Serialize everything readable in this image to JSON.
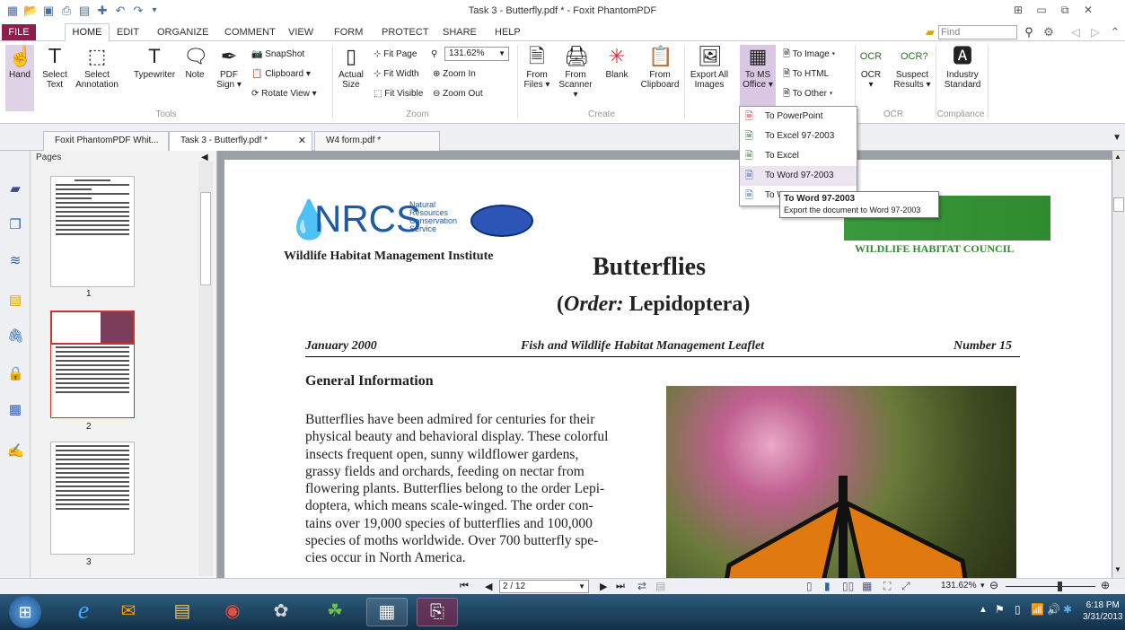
{
  "app": {
    "title": "Task 3 - Butterfly.pdf * - Foxit PhantomPDF"
  },
  "menu": {
    "file": "FILE",
    "tabs": [
      "HOME",
      "EDIT",
      "ORGANIZE",
      "COMMENT",
      "VIEW",
      "FORM",
      "PROTECT",
      "SHARE",
      "HELP"
    ],
    "find_placeholder": "Find"
  },
  "ribbon": {
    "tools": {
      "hand": "Hand",
      "select_text": [
        "Select",
        "Text"
      ],
      "select_annotation": [
        "Select",
        "Annotation"
      ],
      "typewriter": "Typewriter",
      "note": "Note",
      "pdf_sign": [
        "PDF",
        "Sign ▾"
      ],
      "snapshot": "SnapShot",
      "clipboard": "Clipboard ▾",
      "rotate_view": "Rotate View ▾",
      "group_label": "Tools"
    },
    "zoom": {
      "actual_size": [
        "Actual",
        "Size"
      ],
      "fit_page": "Fit Page",
      "fit_width": "Fit Width",
      "fit_visible": "Fit Visible",
      "zoom_value": "131.62%",
      "zoom_in": "Zoom In",
      "zoom_out": "Zoom Out",
      "group_label": "Zoom"
    },
    "create": {
      "from_files": [
        "From",
        "Files ▾"
      ],
      "from_scanner": [
        "From",
        "Scanner ▾"
      ],
      "blank": "Blank",
      "from_clipboard": [
        "From",
        "Clipboard"
      ],
      "group_label": "Create"
    },
    "convert": {
      "export_all_images": [
        "Export All",
        "Images"
      ],
      "to_ms_office": [
        "To MS",
        "Office ▾"
      ],
      "to_image": "To Image ▾",
      "to_html": "To HTML",
      "to_other": "To Other ▾"
    },
    "ocr": {
      "ocr": "OCR",
      "suspect_results": [
        "Suspect",
        "Results ▾"
      ],
      "group_label": "OCR"
    },
    "compliance": {
      "industry_standard": [
        "Industry",
        "Standard"
      ],
      "group_label": "Compliance"
    }
  },
  "doc_tabs": [
    "Foxit PhantomPDF Whit...",
    "Task 3 - Butterfly.pdf *",
    "W4 form.pdf *"
  ],
  "pages_panel": {
    "header": "Pages",
    "page_numbers": [
      "1",
      "2",
      "3"
    ]
  },
  "dropdown": {
    "items": [
      "To PowerPoint",
      "To Excel 97-2003",
      "To Excel",
      "To Word 97-2003",
      "To W"
    ]
  },
  "tooltip": {
    "title": "To Word 97-2003",
    "text": "Export the document to Word 97-2003"
  },
  "document": {
    "nrcs_logo": "NRCS",
    "nrcs_sub": [
      "Natural",
      "Resources",
      "Conservation",
      "Service"
    ],
    "institute": "Wildlife Habitat Management Institute",
    "whc": "WILDLIFE HABITAT COUNCIL",
    "title": "Butterflies",
    "subtitle_prefix": "(",
    "subtitle_order": "Order:",
    "subtitle_name": " Lepidoptera",
    "subtitle_suffix": ")",
    "date": "January 2000",
    "leaflet": "Fish and Wildlife Habitat Management Leaflet",
    "number": "Number 15",
    "section": "General Information",
    "body_lines": [
      "Butterflies have been admired for centuries for their",
      "physical beauty and behavioral display. These colorful",
      "insects frequent open, sunny wildflower gardens,",
      "grassy fields and orchards, feeding on nectar from",
      "flowering plants.  Butterflies belong to the order Lepi-",
      "doptera, which means scale-winged.  The order con-",
      "tains over 19,000 species of butterflies and 100,000",
      "species of moths worldwide.  Over 700 butterfly spe-",
      "cies occur in North America."
    ]
  },
  "status": {
    "page_box": "2 / 12",
    "zoom": "131.62%"
  },
  "taskbar": {
    "time": "6:18 PM",
    "date": "3/31/2013"
  },
  "colors": {
    "file_tab": "#8d1f4e",
    "selected_button": "#d9c7e3",
    "nrcs_blue": "#1f5aa6",
    "whc_green": "#2e8b2e"
  }
}
